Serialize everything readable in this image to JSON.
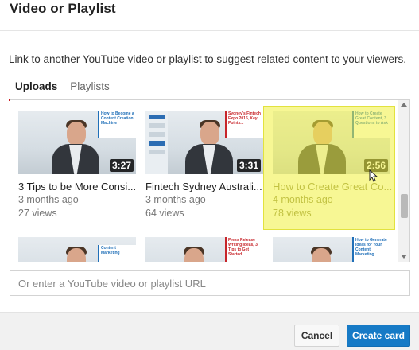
{
  "dialog": {
    "title": "Video or Playlist",
    "description": "Link to another YouTube video or playlist to suggest related content to your viewers."
  },
  "tabs": [
    {
      "label": "Uploads",
      "active": true
    },
    {
      "label": "Playlists",
      "active": false
    }
  ],
  "videos": [
    {
      "title": "3 Tips to be More Consi...",
      "age": "3 months ago",
      "views": "27 views",
      "duration": "3:27",
      "banner": "How to Become a Content Creation Machine",
      "selected": false
    },
    {
      "title": "Fintech Sydney Australi...",
      "age": "3 months ago",
      "views": "64 views",
      "duration": "3:31",
      "banner": "Sydney's Fintech Expo 2015, Key Points...",
      "selected": false
    },
    {
      "title": "How to Create Great Co...",
      "age": "4 months ago",
      "views": "78 views",
      "duration": "2:56",
      "banner": "How to Create Great Content, 3 Questions to Ask",
      "selected": true
    }
  ],
  "partial_row_banners": [
    "Content Marketing",
    "Press Release Writing Ideas, 3 Tips to Get Started",
    "How to Generate Ideas for Your Content Marketing"
  ],
  "url_input": {
    "value": "",
    "placeholder": "Or enter a YouTube video or playlist URL"
  },
  "buttons": {
    "cancel": "Cancel",
    "create": "Create card"
  },
  "colors": {
    "accent_blue": "#167ac6",
    "tab_underline_red": "#cc181e",
    "selection_yellow": "#f0f03c"
  }
}
